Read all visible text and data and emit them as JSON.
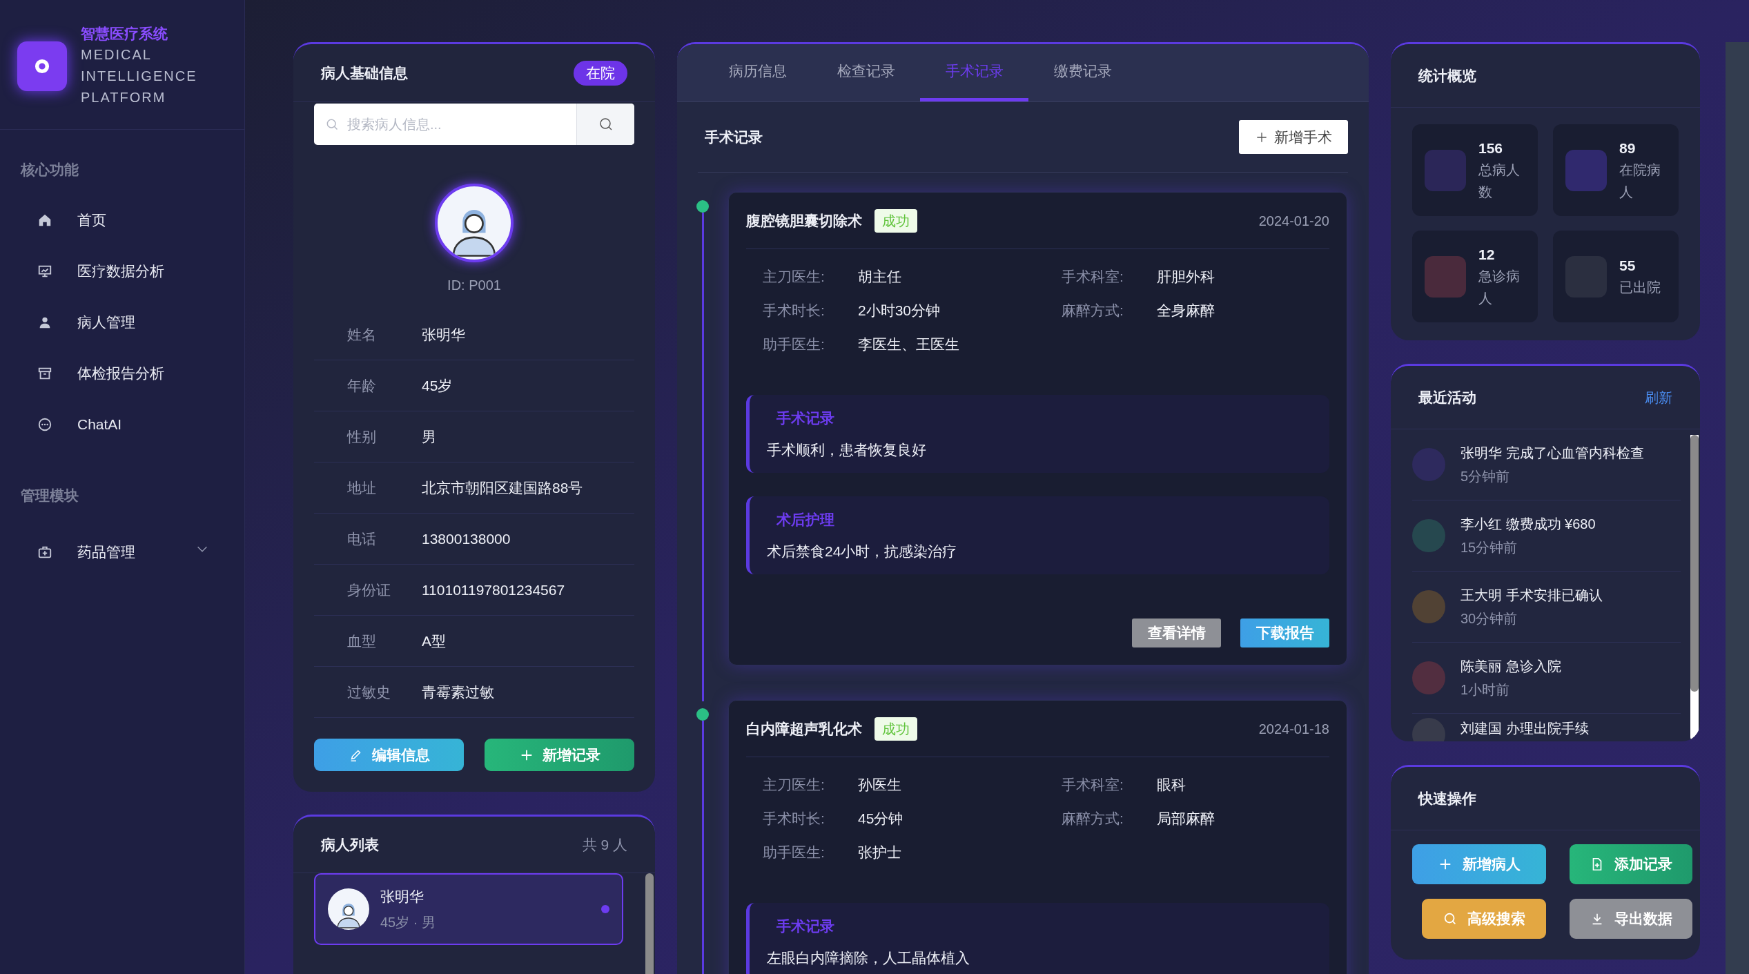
{
  "sidebar": {
    "logo": {
      "title": "智慧医疗系统",
      "subtitle_lines": [
        "MEDICAL",
        "INTELLIGENCE",
        "PLATFORM"
      ]
    },
    "sections": [
      {
        "title": "核心功能",
        "items": [
          {
            "label": "首页"
          },
          {
            "label": "医疗数据分析"
          },
          {
            "label": "病人管理"
          },
          {
            "label": "体检报告分析"
          },
          {
            "label": "ChatAI"
          }
        ]
      },
      {
        "title": "管理模块",
        "items": [
          {
            "label": "药品管理",
            "expanded": false
          }
        ]
      }
    ]
  },
  "patient_info": {
    "title": "病人基础信息",
    "status_badge": "在院",
    "search": {
      "placeholder": "搜索病人信息..."
    },
    "patient_id": "ID: P001",
    "fields": [
      {
        "label": "姓名",
        "value": "张明华"
      },
      {
        "label": "年龄",
        "value": "45岁"
      },
      {
        "label": "性别",
        "value": "男"
      },
      {
        "label": "地址",
        "value": "北京市朝阳区建国路88号"
      },
      {
        "label": "电话",
        "value": "13800138000"
      },
      {
        "label": "身份证",
        "value": "110101197801234567"
      },
      {
        "label": "血型",
        "value": "A型"
      },
      {
        "label": "过敏史",
        "value": "青霉素过敏"
      }
    ],
    "buttons": [
      "编辑信息",
      "新增记录"
    ]
  },
  "patient_list": {
    "title": "病人列表",
    "count": "共 9 人",
    "items": [
      {
        "name": "张明华",
        "meta": "45岁 · 男",
        "selected": true
      }
    ]
  },
  "tabs": [
    {
      "label": "病历信息",
      "selected": false
    },
    {
      "label": "检查记录",
      "selected": false
    },
    {
      "label": "手术记录",
      "selected": true
    },
    {
      "label": "缴费记录",
      "selected": false
    }
  ],
  "surgery": {
    "title": "手术记录",
    "add_button": "新增手术",
    "records": [
      {
        "name": "腹腔镜胆囊切除术",
        "status": {
          "label": "成功",
          "kind": "success"
        },
        "date": "2024-01-20",
        "fields": [
          {
            "label": "主刀医生:",
            "value": "胡主任"
          },
          {
            "label": "手术科室:",
            "value": "肝胆外科"
          },
          {
            "label": "手术时长:",
            "value": "2小时30分钟"
          },
          {
            "label": "麻醉方式:",
            "value": "全身麻醉"
          },
          {
            "label": "助手医生:",
            "value": "李医生、王医生"
          }
        ],
        "notes": [
          {
            "title": "手术记录",
            "text": "手术顺利，患者恢复良好"
          },
          {
            "title": "术后护理",
            "text": "术后禁食24小时，抗感染治疗"
          }
        ],
        "actions": [
          "查看详情",
          "下载报告"
        ]
      },
      {
        "name": "白内障超声乳化术",
        "status": {
          "label": "成功",
          "kind": "success"
        },
        "date": "2024-01-18",
        "fields": [
          {
            "label": "主刀医生:",
            "value": "孙医生"
          },
          {
            "label": "手术科室:",
            "value": "眼科"
          },
          {
            "label": "手术时长:",
            "value": "45分钟"
          },
          {
            "label": "麻醉方式:",
            "value": "局部麻醉"
          },
          {
            "label": "助手医生:",
            "value": "张护士"
          }
        ],
        "notes": [
          {
            "title": "手术记录",
            "text": "左眼白内障摘除，人工晶体植入"
          }
        ]
      }
    ]
  },
  "stats": {
    "title": "统计概览",
    "items": [
      {
        "value": "156",
        "label": "总病人数",
        "color": "#2b2658"
      },
      {
        "value": "89",
        "label": "在院病人",
        "color": "#30296e"
      },
      {
        "value": "12",
        "label": "急诊病人",
        "color": "#4a2a3c"
      },
      {
        "value": "55",
        "label": "已出院",
        "color": "#2b2f40"
      }
    ]
  },
  "activity": {
    "title": "最近活动",
    "refresh": "刷新",
    "items": [
      {
        "text": "张明华 完成了心血管内科检查",
        "time": "5分钟前",
        "color": "#2e2a5e"
      },
      {
        "text": "李小红 缴费成功 ¥680",
        "time": "15分钟前",
        "color": "#26484f"
      },
      {
        "text": "王大明 手术安排已确认",
        "time": "30分钟前",
        "color": "#514234"
      },
      {
        "text": "陈美丽 急诊入院",
        "time": "1小时前",
        "color": "#522e40"
      },
      {
        "text": "刘建国 办理出院手续",
        "color": "#383b4b"
      }
    ]
  },
  "quick_actions": {
    "title": "快速操作",
    "buttons": [
      {
        "label": "新增病人",
        "kind": "primary"
      },
      {
        "label": "添加记录",
        "kind": "success"
      },
      {
        "label": "高级搜索",
        "kind": "warning"
      },
      {
        "label": "导出数据",
        "kind": "neutral"
      }
    ]
  }
}
